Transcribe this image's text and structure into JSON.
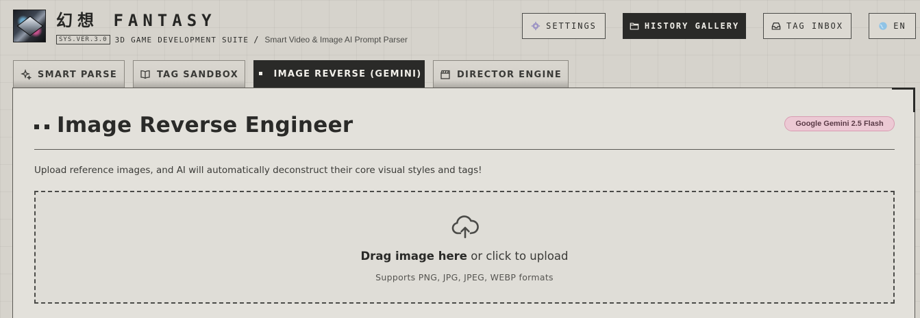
{
  "header": {
    "brand_title": "幻想 FANTASY",
    "version": "SYS.VER.3.0",
    "suite": "3D GAME DEVELOPMENT SUITE",
    "separator": "/",
    "tagline": "Smart Video & Image AI Prompt Parser",
    "logo_icon": "cube-logo-icon"
  },
  "toolbar": {
    "settings_label": "SETTINGS",
    "settings_icon": "gear-icon",
    "history_label": "HISTORY GALLERY",
    "history_icon": "folder-icon",
    "inbox_label": "TAG INBOX",
    "inbox_icon": "inbox-icon",
    "lang_label": "EN",
    "lang_icon": "globe-icon"
  },
  "tabs": [
    {
      "label": "SMART PARSE",
      "icon": "sparkles-icon",
      "active": false
    },
    {
      "label": "TAG SANDBOX",
      "icon": "book-icon",
      "active": false
    },
    {
      "label": "IMAGE REVERSE (GEMINI)",
      "icon": "square-icon",
      "active": true
    },
    {
      "label": "DIRECTOR ENGINE",
      "icon": "clapperboard-icon",
      "active": false
    }
  ],
  "main": {
    "title": "Image Reverse Engineer",
    "model_badge": "Google Gemini 2.5 Flash",
    "intro": "Upload reference images, and AI will automatically deconstruct their core visual styles and tags!",
    "dropzone": {
      "icon": "cloud-upload-icon",
      "main_bold": "Drag image here",
      "main_rest": " or click to upload",
      "hint": "Supports PNG, JPG, JPEG, WEBP formats"
    }
  },
  "colors": {
    "background": "#d6d3cc",
    "panel": "#e3e1db",
    "dark": "#2a2a28",
    "badge_pink": "#ecc9d4"
  }
}
